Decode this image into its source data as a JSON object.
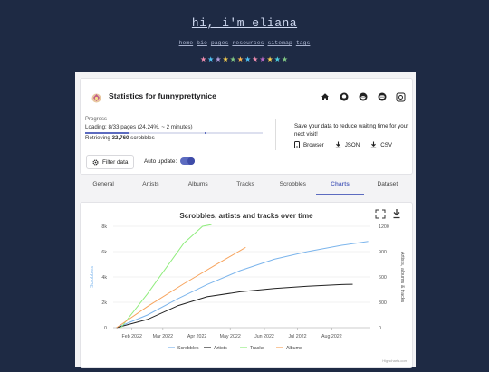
{
  "site": {
    "title": "hi, i'm eliana",
    "nav": [
      "home",
      "bio",
      "pages",
      "resources",
      "sitemap",
      "tags"
    ],
    "stars": [
      {
        "glyph": "★",
        "color": "#f48fb1"
      },
      {
        "glyph": "★",
        "color": "#4fc3f7"
      },
      {
        "glyph": "★",
        "color": "#b39ddb"
      },
      {
        "glyph": "★",
        "color": "#ffd54f"
      },
      {
        "glyph": "★",
        "color": "#81c784"
      },
      {
        "glyph": "★",
        "color": "#ffb74d"
      },
      {
        "glyph": "★",
        "color": "#4fc3f7"
      },
      {
        "glyph": "★",
        "color": "#f48fb1"
      },
      {
        "glyph": "★",
        "color": "#ba68c8"
      },
      {
        "glyph": "★",
        "color": "#ffd54f"
      },
      {
        "glyph": "★",
        "color": "#4dd0e1"
      },
      {
        "glyph": "★",
        "color": "#81c784"
      }
    ]
  },
  "stats": {
    "title": "Statistics for funnyprettynice",
    "icons": [
      "home-icon",
      "github-icon",
      "reddit-icon",
      "discord-icon",
      "settings-icon"
    ],
    "progress_label": "Progress",
    "progress_text": "Loading: 8/33 pages (24.24%, ~ 2 minutes)",
    "progress_fraction": 0.2424,
    "retrieving_prefix": "Retrieving ",
    "retrieving_count": "32,760",
    "retrieving_suffix": " scrobbles",
    "save_text": "Save your data to reduce waiting time for your next visit!",
    "downloads": [
      "Browser",
      "JSON",
      "CSV"
    ],
    "filter_label": "Filter data",
    "auto_update_label": "Auto update:",
    "auto_update_on": true
  },
  "tabs": {
    "items": [
      "General",
      "Artists",
      "Albums",
      "Tracks",
      "Scrobbles",
      "Charts",
      "Dataset"
    ],
    "active": "Charts"
  },
  "chart_data": {
    "type": "line",
    "title": "Scrobbles, artists and tracks over time",
    "x_ticks": [
      "Feb 2022",
      "Mar 2022",
      "Apr 2022",
      "May 2022",
      "Jun 2022",
      "Jul 2022",
      "Aug 2022"
    ],
    "y_left_label": "Scrobbles",
    "y_left_ticks": [
      "8k",
      "6k",
      "4k",
      "2k",
      "0"
    ],
    "y_left_range": [
      0,
      8000
    ],
    "y_right_label": "Artists, albums & tracks",
    "y_right_ticks": [
      "1200",
      "900",
      "600",
      "300",
      "0"
    ],
    "y_right_range": [
      0,
      1200
    ],
    "x_range": [
      "2022-01-15",
      "2022-09-05"
    ],
    "series": [
      {
        "name": "Scrobbles",
        "axis": "left",
        "color": "#7cb5ec",
        "points": [
          [
            "2022-01-18",
            0
          ],
          [
            "2022-02-15",
            1000
          ],
          [
            "2022-03-15",
            2300
          ],
          [
            "2022-04-10",
            3400
          ],
          [
            "2022-05-10",
            4500
          ],
          [
            "2022-06-10",
            5400
          ],
          [
            "2022-07-10",
            6000
          ],
          [
            "2022-08-10",
            6500
          ],
          [
            "2022-09-03",
            6800
          ]
        ]
      },
      {
        "name": "Artists",
        "axis": "left_scaled",
        "color": "#222222",
        "points": [
          [
            "2022-01-18",
            0
          ],
          [
            "2022-02-15",
            150
          ],
          [
            "2022-03-15",
            400
          ],
          [
            "2022-04-10",
            560
          ],
          [
            "2022-05-10",
            650
          ],
          [
            "2022-06-10",
            710
          ],
          [
            "2022-07-10",
            750
          ],
          [
            "2022-08-10",
            780
          ],
          [
            "2022-08-20",
            785
          ]
        ]
      },
      {
        "name": "Tracks",
        "axis": "right",
        "color": "#90ed7d",
        "points": [
          [
            "2022-01-22",
            0
          ],
          [
            "2022-02-15",
            400
          ],
          [
            "2022-03-20",
            1000
          ],
          [
            "2022-04-06",
            1200
          ],
          [
            "2022-04-14",
            1220
          ]
        ]
      },
      {
        "name": "Albums",
        "axis": "right",
        "color": "#f7a35c",
        "points": [
          [
            "2022-01-18",
            0
          ],
          [
            "2022-02-15",
            250
          ],
          [
            "2022-03-20",
            520
          ],
          [
            "2022-04-20",
            760
          ],
          [
            "2022-05-15",
            950
          ]
        ]
      }
    ],
    "legend": [
      "Scrobbles",
      "Artists",
      "Tracks",
      "Albums"
    ],
    "credit": "Highcharts.com"
  }
}
